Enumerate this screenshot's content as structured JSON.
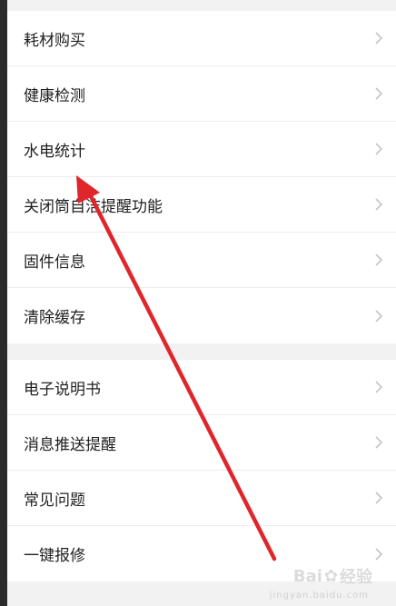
{
  "groups": [
    {
      "items": [
        {
          "label": "耗材购买"
        },
        {
          "label": "健康检测"
        },
        {
          "label": "水电统计"
        },
        {
          "label": "关闭筒自洁提醒功能"
        },
        {
          "label": "固件信息"
        },
        {
          "label": "清除缓存"
        }
      ]
    },
    {
      "items": [
        {
          "label": "电子说明书"
        },
        {
          "label": "消息推送提醒"
        },
        {
          "label": "常见问题"
        },
        {
          "label": "一键报修"
        }
      ]
    }
  ],
  "annotation": {
    "arrow_color": "#e0252b"
  },
  "watermark": {
    "text_left": "Bai",
    "text_right": "经验",
    "sub": "jingyan.baidu.com"
  }
}
